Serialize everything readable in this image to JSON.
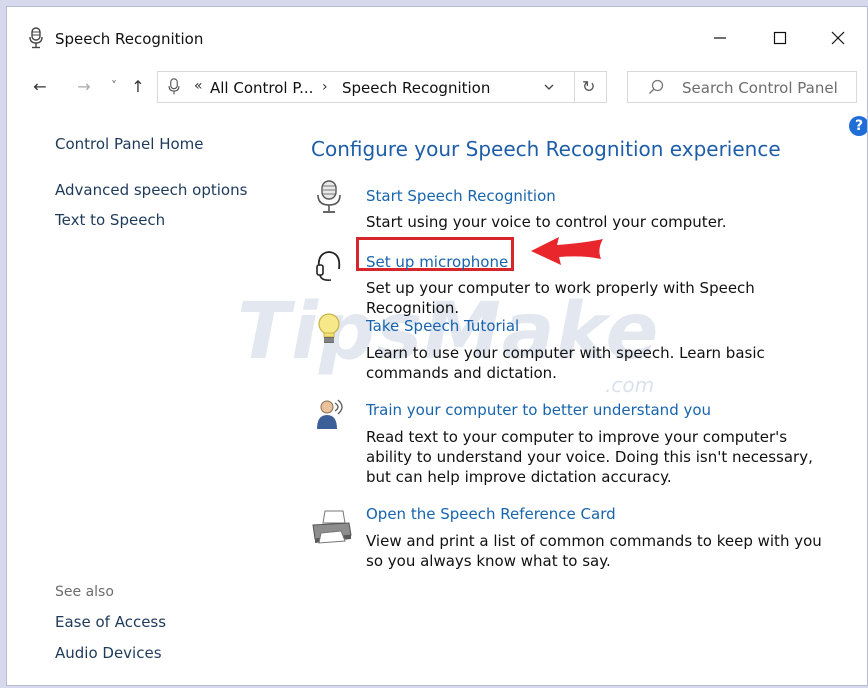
{
  "window": {
    "title": "Speech Recognition",
    "controls": {
      "minimize": "–",
      "maximize": "☐",
      "close": "✕"
    }
  },
  "nav": {
    "back": "←",
    "forward": "→",
    "recent": "˅",
    "up": "↑",
    "address": {
      "separator1": "«",
      "crumb1": "All Control P...",
      "separator2": "›",
      "crumb2": "Speech Recognition",
      "dropdown": "⌄",
      "refresh": "↻"
    },
    "search": {
      "placeholder": "Search Control Panel"
    }
  },
  "left_pane": {
    "links": [
      "Control Panel Home",
      "Advanced speech options",
      "Text to Speech"
    ],
    "see_also_label": "See also",
    "see_also": [
      "Ease of Access",
      "Audio Devices"
    ]
  },
  "main": {
    "heading": "Configure your Speech Recognition experience",
    "items": [
      {
        "icon": "microphone-icon",
        "link": "Start Speech Recognition",
        "desc": "Start using your voice to control your computer."
      },
      {
        "icon": "headset-icon",
        "link": "Set up microphone",
        "desc": "Set up your computer to work properly with Speech Recognition."
      },
      {
        "icon": "lightbulb-icon",
        "link": "Take Speech Tutorial",
        "desc": "Learn to use your computer with speech.  Learn basic commands and dictation."
      },
      {
        "icon": "user-speaking-icon",
        "link": "Train your computer to better understand you",
        "desc": "Read text to your computer to improve your computer's ability to understand your voice.  Doing this isn't necessary, but can help improve dictation accuracy."
      },
      {
        "icon": "printer-icon",
        "link": "Open the Speech Reference Card",
        "desc": "View and print a list of common commands to keep with you so you always know what to say."
      }
    ]
  },
  "help": "?",
  "watermark": {
    "main": "TipsMake",
    "sub": ".com"
  },
  "colors": {
    "link": "#1864ad",
    "heading": "#1e5ea8",
    "highlight": "#d7262b",
    "arrow": "#e8262b"
  }
}
